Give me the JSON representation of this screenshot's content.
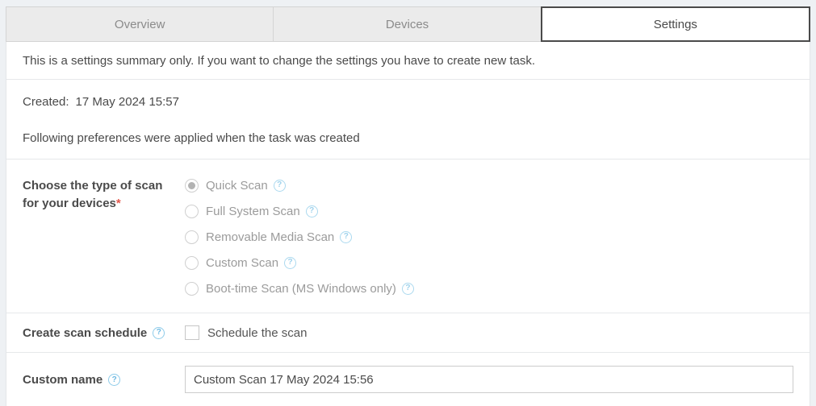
{
  "tabs": [
    {
      "label": "Overview",
      "active": false
    },
    {
      "label": "Devices",
      "active": false
    },
    {
      "label": "Settings",
      "active": true
    }
  ],
  "summary_note": "This is a settings summary only. If you want to change the settings you have to create new task.",
  "created": {
    "label": "Created:",
    "value": "17 May 2024 15:57"
  },
  "preferences_note": "Following preferences were applied when the task was created",
  "scan_type": {
    "label": "Choose the type of scan for your devices",
    "required_marker": "*",
    "options": [
      {
        "label": "Quick Scan",
        "selected": true
      },
      {
        "label": "Full System Scan",
        "selected": false
      },
      {
        "label": "Removable Media Scan",
        "selected": false
      },
      {
        "label": "Custom Scan",
        "selected": false
      },
      {
        "label": "Boot-time Scan (MS Windows only)",
        "selected": false
      }
    ]
  },
  "schedule": {
    "label": "Create scan schedule",
    "checkbox_label": "Schedule the scan",
    "checked": false
  },
  "custom_name": {
    "label": "Custom name",
    "value": "Custom Scan 17 May 2024 15:56"
  },
  "icons": {
    "help": "?"
  },
  "colors": {
    "page_background": "#eef1f4",
    "content_background": "#ffffff",
    "inactive_tab_background": "#ebebeb",
    "active_tab_border": "#4a4a4a",
    "body_text": "#4a4a4a",
    "disabled_text": "#9b9b9b",
    "help_icon_blue": "#6db9e2",
    "required_red": "#e2574c",
    "divider": "#e6e8ea"
  }
}
